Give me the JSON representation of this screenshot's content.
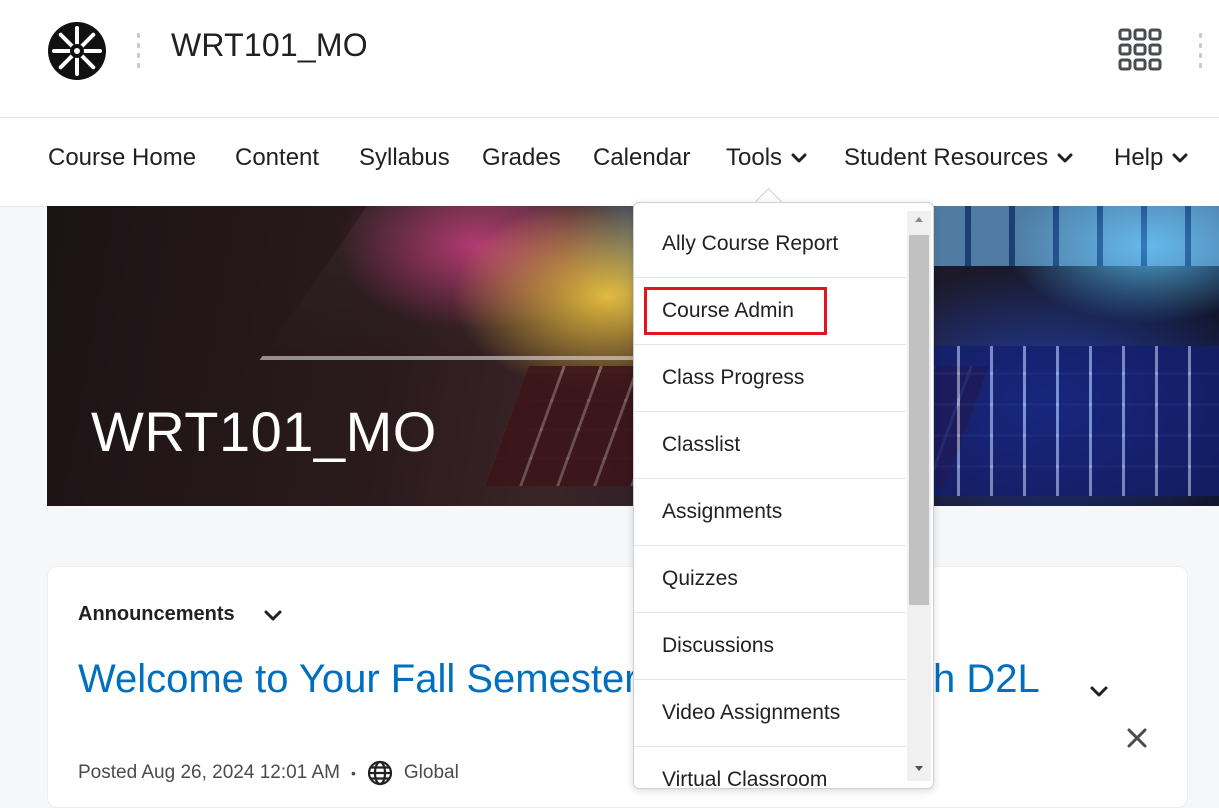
{
  "header": {
    "course_title": "WRT101_MO",
    "logo_icon": "school-seal-logo",
    "apps_icon": "waffle-grid-icon"
  },
  "nav": {
    "items": [
      {
        "label": "Course Home",
        "has_menu": false
      },
      {
        "label": "Content",
        "has_menu": false
      },
      {
        "label": "Syllabus",
        "has_menu": false
      },
      {
        "label": "Grades",
        "has_menu": false
      },
      {
        "label": "Calendar",
        "has_menu": false
      },
      {
        "label": "Tools",
        "has_menu": true,
        "expanded": true
      },
      {
        "label": "Student Resources",
        "has_menu": true
      },
      {
        "label": "Help",
        "has_menu": true
      }
    ]
  },
  "banner": {
    "title": "WRT101_MO"
  },
  "tools_menu": {
    "items": [
      {
        "label": "Ally Course Report"
      },
      {
        "label": "Course Admin",
        "highlighted": true
      },
      {
        "label": "Class Progress"
      },
      {
        "label": "Classlist"
      },
      {
        "label": "Assignments"
      },
      {
        "label": "Quizzes"
      },
      {
        "label": "Discussions"
      },
      {
        "label": "Video Assignments"
      },
      {
        "label": "Virtual Classroom"
      }
    ],
    "highlight_color": "#e3141f"
  },
  "announcements": {
    "label": "Announcements",
    "headline_start": "Welcome to Your Fall Semester",
    "headline_end": "ith D2L",
    "posted": "Posted Aug 26, 2024 12:01 AM",
    "separator": "•",
    "audience": "Global",
    "link_color": "#006fbf"
  }
}
